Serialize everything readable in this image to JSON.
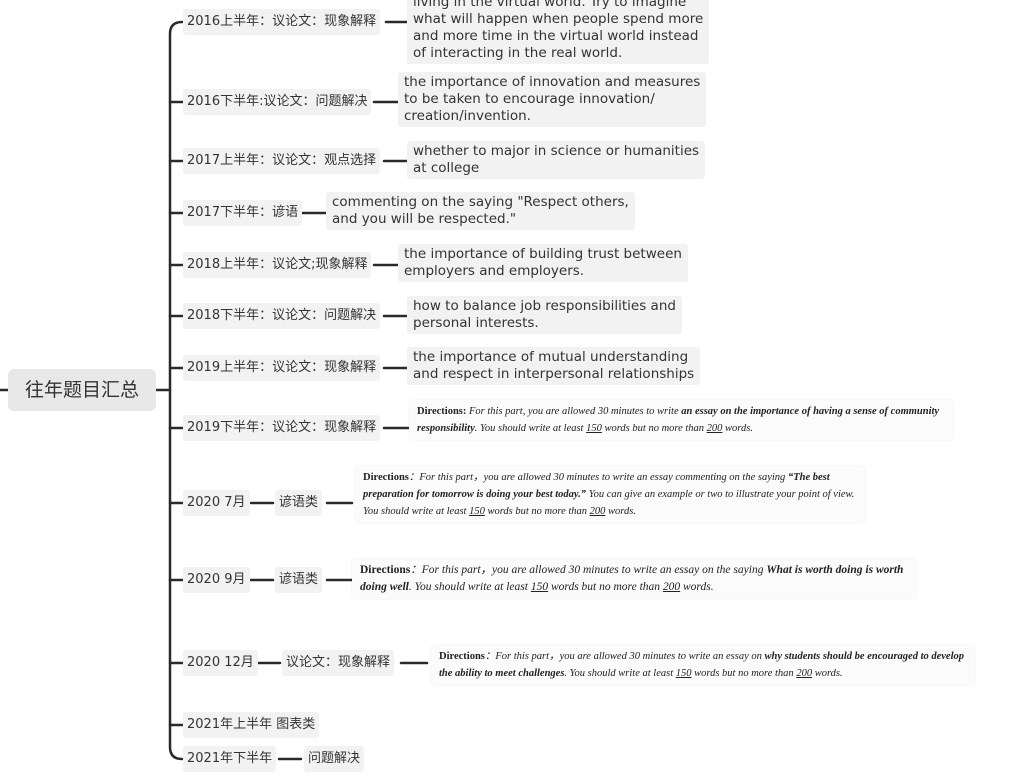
{
  "root": {
    "label": "往年题目汇总"
  },
  "topics": [
    {
      "label": "2016上半年：议论文：现象解释",
      "note_lines": [
        "living in the virtual world. Try to imagine",
        "what will happen when people spend more",
        "and more time in the virtual world instead",
        "of interacting in the real world."
      ]
    },
    {
      "label": "2016下半年:议论文：问题解决",
      "note_lines": [
        "the importance of innovation and measures",
        "to be taken to encourage innovation/",
        "creation/invention."
      ]
    },
    {
      "label": "2017上半年：议论文：观点选择",
      "note_lines": [
        "whether to major in science or humanities",
        "at college"
      ]
    },
    {
      "label": "2017下半年：谚语",
      "note_lines": [
        "commenting on the saying \"Respect others,",
        "and you will be respected.\""
      ]
    },
    {
      "label": "2018上半年：议论文;现象解释",
      "note_lines": [
        "the importance of building trust between",
        "employers and employers."
      ]
    },
    {
      "label": "2018下半年：议论文：问题解决",
      "note_lines": [
        "how to balance job responsibilities and",
        "personal interests."
      ]
    },
    {
      "label": "2019上半年：议论文：现象解释",
      "note_lines": [
        "the importance of mutual understanding",
        "and respect in interpersonal relationships"
      ]
    },
    {
      "label": "2019下半年：议论文：现象解释"
    },
    {
      "label": "2020 7月",
      "sub": "谚语类"
    },
    {
      "label": "2020 9月",
      "sub": "谚语类"
    },
    {
      "label": "2020 12月",
      "sub": "议论文：现象解释"
    },
    {
      "label": "2021年上半年 图表类"
    },
    {
      "label": "2021年下半年",
      "sub": "问题解决"
    }
  ],
  "directions": {
    "d2019b": {
      "lead": "Directions:",
      "t1": " For this part, you are allowed 30 minutes to write ",
      "em": "an essay on the importance of having a sense of community responsibility",
      "t2": ". You should write at least ",
      "n1": "150",
      "t3": " words but no more than ",
      "n2": "200",
      "t4": " words."
    },
    "d2020_7": {
      "lead": "Directions",
      "t1": "：For this part，you are allowed 30 minutes to write an essay commenting on the saying ",
      "em": "“The best preparation for tomorrow is doing your best today.”",
      "t2": " You can give an example or two to illustrate your point of view. You should write at least ",
      "n1": "150",
      "t3": " words but no more than ",
      "n2": "200",
      "t4": " words."
    },
    "d2020_9": {
      "lead": "Directions",
      "t1": "：For this part，you are allowed 30 minutes to write an essay on the saying ",
      "em": "What is worth doing is worth doing well",
      "t2": ". You should write at least ",
      "n1": "150",
      "t3": " words but no more than ",
      "n2": "200",
      "t4": " words."
    },
    "d2020_12": {
      "lead": "Directions",
      "t1": "：For this part，you are allowed 30 minutes to write an essay on ",
      "em": "why students should be encouraged to develop the ability to meet challenges",
      "t2": ". You should write at least ",
      "n1": "150",
      "t3": " words but no more than ",
      "n2": "200",
      "t4": " words."
    }
  }
}
